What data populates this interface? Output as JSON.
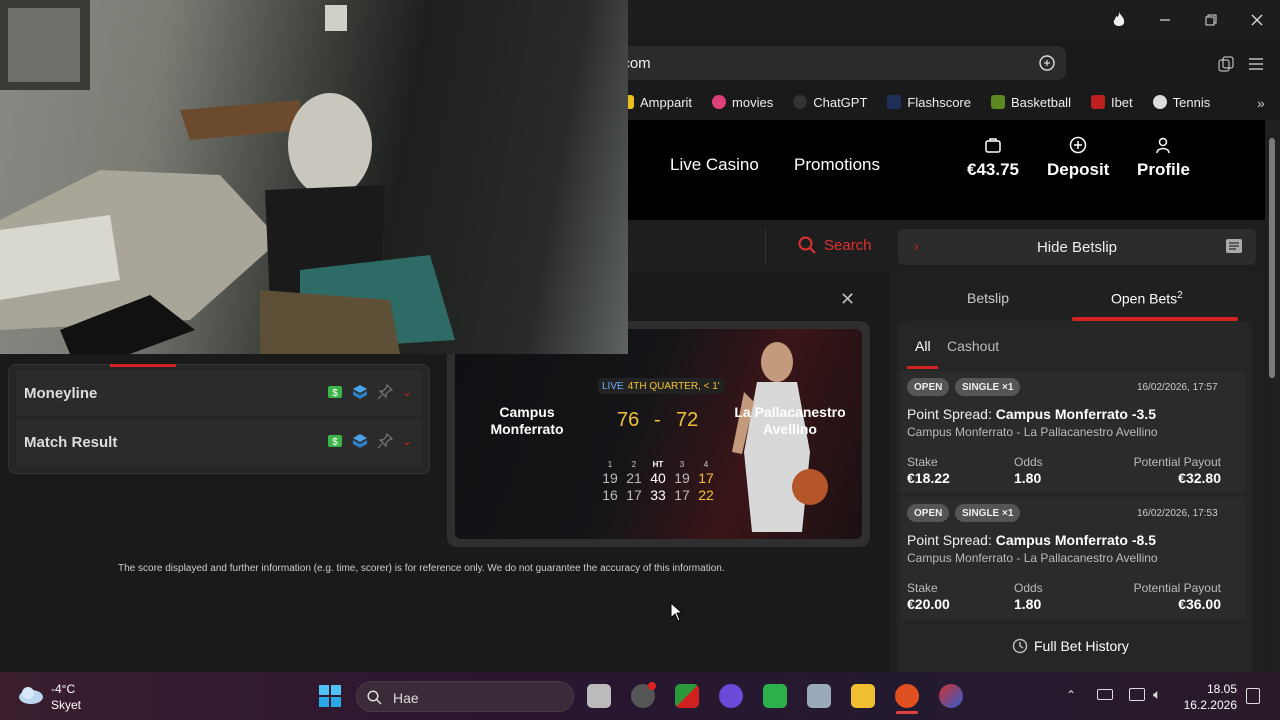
{
  "browser": {
    "url_fragment": "t.com",
    "bookmarks": [
      {
        "label": "Ampparit",
        "color": "#e8c020"
      },
      {
        "label": "movies",
        "color": "#e0407a"
      },
      {
        "label": "ChatGPT",
        "color": "#222222"
      },
      {
        "label": "Flashscore",
        "color": "#20305a"
      },
      {
        "label": "Basketball",
        "color": "#5a8a20"
      },
      {
        "label": "Ibet",
        "color": "#c02020"
      },
      {
        "label": "Tennis",
        "color": "#dddddd"
      }
    ]
  },
  "header": {
    "nav": {
      "live_casino": "Live Casino",
      "promotions": "Promotions"
    },
    "balance": "€43.75",
    "deposit": "Deposit",
    "profile": "Profile"
  },
  "subbar": {
    "search": "Search",
    "hide_betslip": "Hide Betslip"
  },
  "markets": [
    {
      "label": "Moneyline"
    },
    {
      "label": "Match Result"
    }
  ],
  "scoreboard": {
    "home": "Campus Monferrato",
    "away": "La Pallacanestro Avellino",
    "live_label": "LIVE",
    "status": "4TH QUARTER, < 1'",
    "home_score": "76",
    "away_score": "72",
    "separator": "-",
    "period_labels": [
      "1",
      "2",
      "HT",
      "3",
      "4"
    ],
    "home_periods": [
      "19",
      "21",
      "40",
      "19",
      "17"
    ],
    "away_periods": [
      "16",
      "17",
      "33",
      "17",
      "22"
    ]
  },
  "disclaimer": "The score displayed and further information (e.g. time, scorer) is for reference only. We do not guarantee the accuracy of this information.",
  "betslip": {
    "tab_betslip": "Betslip",
    "tab_open_bets": "Open Bets",
    "open_count": "2",
    "filter_all": "All",
    "filter_cashout": "Cashout",
    "bets": [
      {
        "status": "OPEN",
        "type": "SINGLE ×1",
        "date": "16/02/2026, 17:57",
        "market": "Point Spread:",
        "selection": "Campus Monferrato -3.5",
        "event": "Campus Monferrato - La Pallacanestro Avellino",
        "stake_label": "Stake",
        "stake": "€18.22",
        "odds_label": "Odds",
        "odds": "1.80",
        "payout_label": "Potential Payout",
        "payout": "€32.80"
      },
      {
        "status": "OPEN",
        "type": "SINGLE ×1",
        "date": "16/02/2026, 17:53",
        "market": "Point Spread:",
        "selection": "Campus Monferrato -8.5",
        "event": "Campus Monferrato - La Pallacanestro Avellino",
        "stake_label": "Stake",
        "stake": "€20.00",
        "odds_label": "Odds",
        "odds": "1.80",
        "payout_label": "Potential Payout",
        "payout": "€36.00"
      }
    ],
    "history": "Full Bet History"
  },
  "taskbar": {
    "weather_temp": "-4°C",
    "weather_desc": "Skyet",
    "search_placeholder": "Hae",
    "time": "18.05",
    "date": "16.2.2026"
  }
}
